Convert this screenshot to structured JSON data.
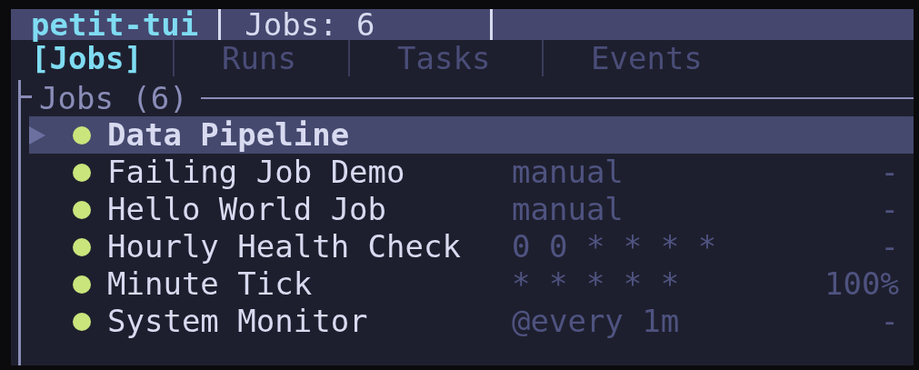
{
  "header": {
    "app_name": "petit-tui",
    "job_count": "Jobs: 6"
  },
  "tabs": [
    {
      "label": "[Jobs]",
      "selected": true
    },
    {
      "label": "Runs",
      "selected": false
    },
    {
      "label": "Tasks",
      "selected": false
    },
    {
      "label": "Events",
      "selected": false
    }
  ],
  "jobs_panel": {
    "title": "Jobs (6)",
    "rows": [
      {
        "name": "Data Pipeline",
        "schedule": "",
        "last": "",
        "selected": true
      },
      {
        "name": "Failing Job Demo",
        "schedule": "manual",
        "last": "-",
        "selected": false
      },
      {
        "name": "Hello World Job",
        "schedule": "manual",
        "last": "-",
        "selected": false
      },
      {
        "name": "Hourly Health Check",
        "schedule": "0 0 * * * *",
        "last": "-",
        "selected": false
      },
      {
        "name": "Minute Tick",
        "schedule": "* * * * *",
        "last": "100%",
        "selected": false
      },
      {
        "name": "System Monitor",
        "schedule": "@every 1m",
        "last": "-",
        "selected": false
      }
    ]
  }
}
